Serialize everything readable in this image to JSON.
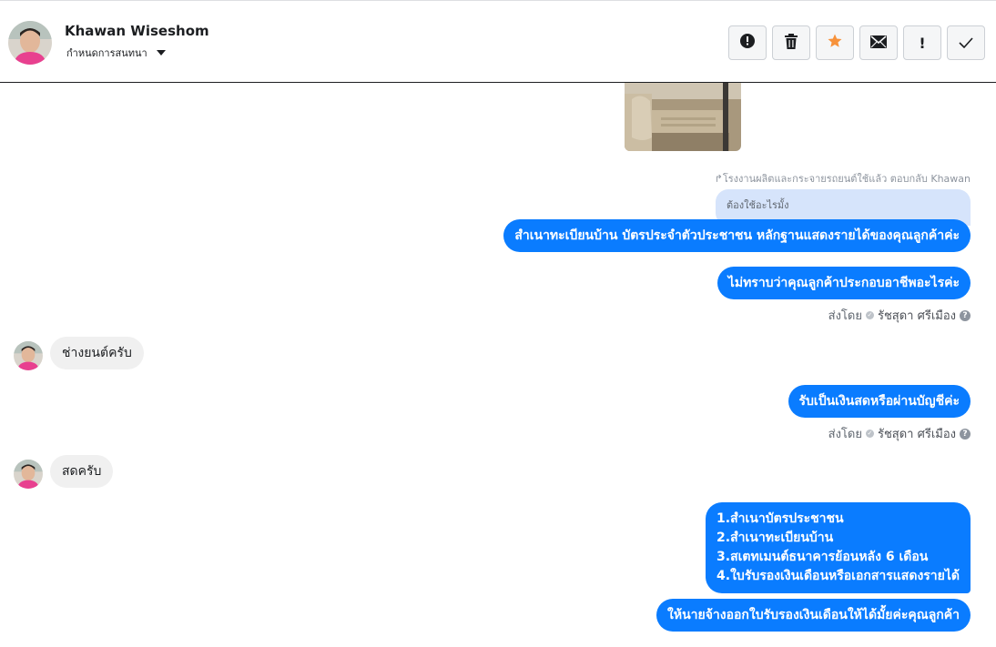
{
  "header": {
    "name": "Khawan Wiseshom",
    "subtitle": "กำหนดการสนทนา",
    "tools": [
      {
        "icon": "alert-circle-icon"
      },
      {
        "icon": "trash-icon"
      },
      {
        "icon": "star-icon",
        "color": "#f7923b"
      },
      {
        "icon": "envelope-icon"
      },
      {
        "icon": "exclamation-icon",
        "label": "!"
      },
      {
        "icon": "checkmark-icon"
      }
    ]
  },
  "chat": {
    "reply_meta": "โรงงานผลิตและกระจายรถยนต์ใช้แล้ว ตอบกลับ Khawan",
    "reply_quote": "ต้องใช้อะไรมั้ง",
    "messages": [
      {
        "side": "out",
        "text": "สำเนาทะเบียนบ้าน บัตรประจำตัวประชาชน หลักฐานแสดงรายได้ของคุณลูกค้าค่ะ"
      },
      {
        "side": "out",
        "text": "ไม่ทราบว่าคุณลูกค้าประกอบอาชีพอะไรค่ะ"
      },
      {
        "side": "in",
        "text": "ช่างยนต์ครับ"
      },
      {
        "side": "out",
        "text": "รับเป็นเงินสดหรือผ่านบัญชีค่ะ"
      },
      {
        "side": "in",
        "text": "สดครับ"
      },
      {
        "side": "out",
        "lines": [
          "1.สำเนาบัตรประชาชน",
          "2.สำเนาทะเบียนบ้าน",
          "3.สเตทเมนต์ธนาคารย้อนหลัง 6 เดือน",
          "4.ใบรับรองเงินเดือนหรือเอกสารแสดงรายได้"
        ]
      },
      {
        "side": "out",
        "text": "ให้นายจ้างออกใบรับรองเงินเดือนให้ได้มั้ยค่ะคุณลูกค้า"
      }
    ],
    "sent_by_label": "ส่งโดย",
    "sent_by_agent": "รัชสุดา ศรีเมือง",
    "help_glyph": "?"
  },
  "colors": {
    "outgoing_bubble": "#0a7cff",
    "incoming_bubble": "#f0f0f0",
    "reply_quote_bg": "#d6e4fb"
  }
}
